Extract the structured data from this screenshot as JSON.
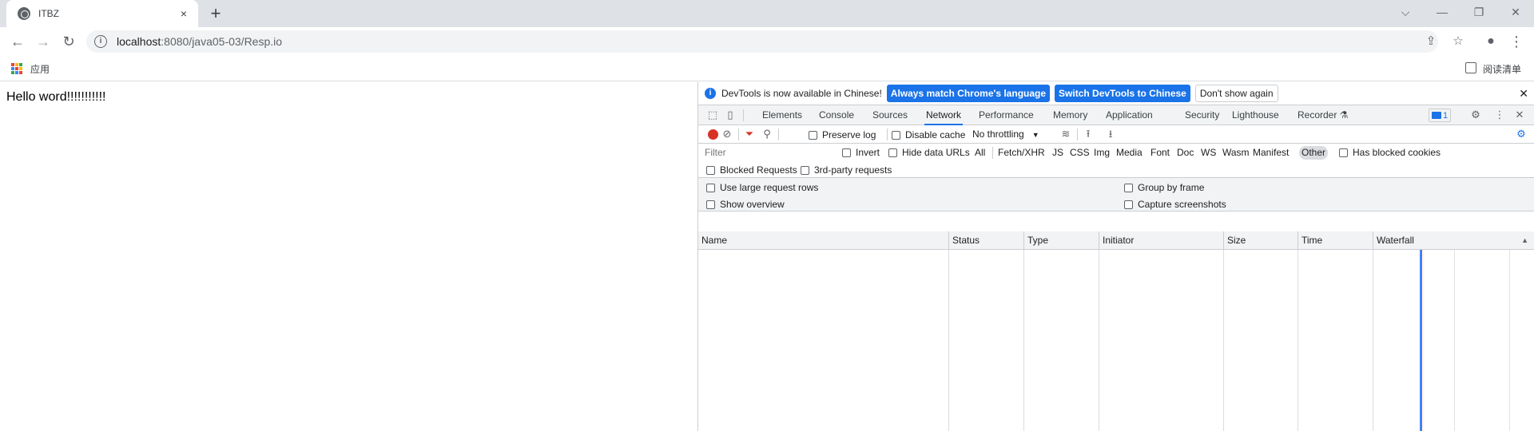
{
  "tab": {
    "title": "ITBZ",
    "close": "×"
  },
  "newtab": "+",
  "window": {
    "dropdown": "⌵",
    "minimize": "—",
    "restore": "❐",
    "close": "✕"
  },
  "toolbar": {
    "back": "←",
    "forward": "→",
    "reload": "↻",
    "url_host": "localhost",
    "url_rest": ":8080/java05-03/Resp.io",
    "share": "⇪",
    "star": "☆",
    "profile": "●",
    "menu": "⋮"
  },
  "bookmarks": {
    "apps_label": "应用",
    "apps_colors": [
      "#ea4335",
      "#fbbc04",
      "#34a853",
      "#4285f4",
      "#ea4335",
      "#fbbc04",
      "#34a853",
      "#4285f4",
      "#ea4335"
    ],
    "reading_list": "阅读清单"
  },
  "page": {
    "text": "Hello word!!!!!!!!!!!"
  },
  "devtools": {
    "infobar": {
      "icon": "i",
      "message": "DevTools is now available in Chinese!",
      "btn_match": "Always match Chrome's language",
      "btn_switch": "Switch DevTools to Chinese",
      "btn_dismiss": "Don't show again",
      "close": "✕"
    },
    "tabs": [
      "Elements",
      "Console",
      "Sources",
      "Network",
      "Performance",
      "Memory",
      "Application",
      "Security",
      "Lighthouse",
      "Recorder ⚗"
    ],
    "active_tab": "Network",
    "badge_count": "1",
    "icons": {
      "inspect": "⬚",
      "device": "▯",
      "gear": "⚙",
      "more": "⋮",
      "close": "✕"
    },
    "network_toolbar": {
      "clear": "⊘",
      "filter": "⏷",
      "search": "⚲",
      "preserve_log": "Preserve log",
      "disable_cache": "Disable cache",
      "throttling": "No throttling",
      "throttle_arrow": "▼",
      "wifi": "📶",
      "upload": "⭱",
      "download": "⭳",
      "settings": "⚙"
    },
    "filter": {
      "placeholder": "Filter",
      "invert": "Invert",
      "hide_data_urls": "Hide data URLs",
      "types": [
        "All",
        "Fetch/XHR",
        "JS",
        "CSS",
        "Img",
        "Media",
        "Font",
        "Doc",
        "WS",
        "Wasm",
        "Manifest",
        "Other"
      ],
      "selected_type": "Other",
      "has_blocked_cookies": "Has blocked cookies",
      "blocked_requests": "Blocked Requests",
      "third_party": "3rd-party requests"
    },
    "settings": {
      "large_rows": "Use large request rows",
      "show_overview": "Show overview",
      "group_by_frame": "Group by frame",
      "capture_screenshots": "Capture screenshots"
    },
    "table": {
      "columns": [
        "Name",
        "Status",
        "Type",
        "Initiator",
        "Size",
        "Time",
        "Waterfall"
      ],
      "sort_arrow": "▲"
    }
  }
}
